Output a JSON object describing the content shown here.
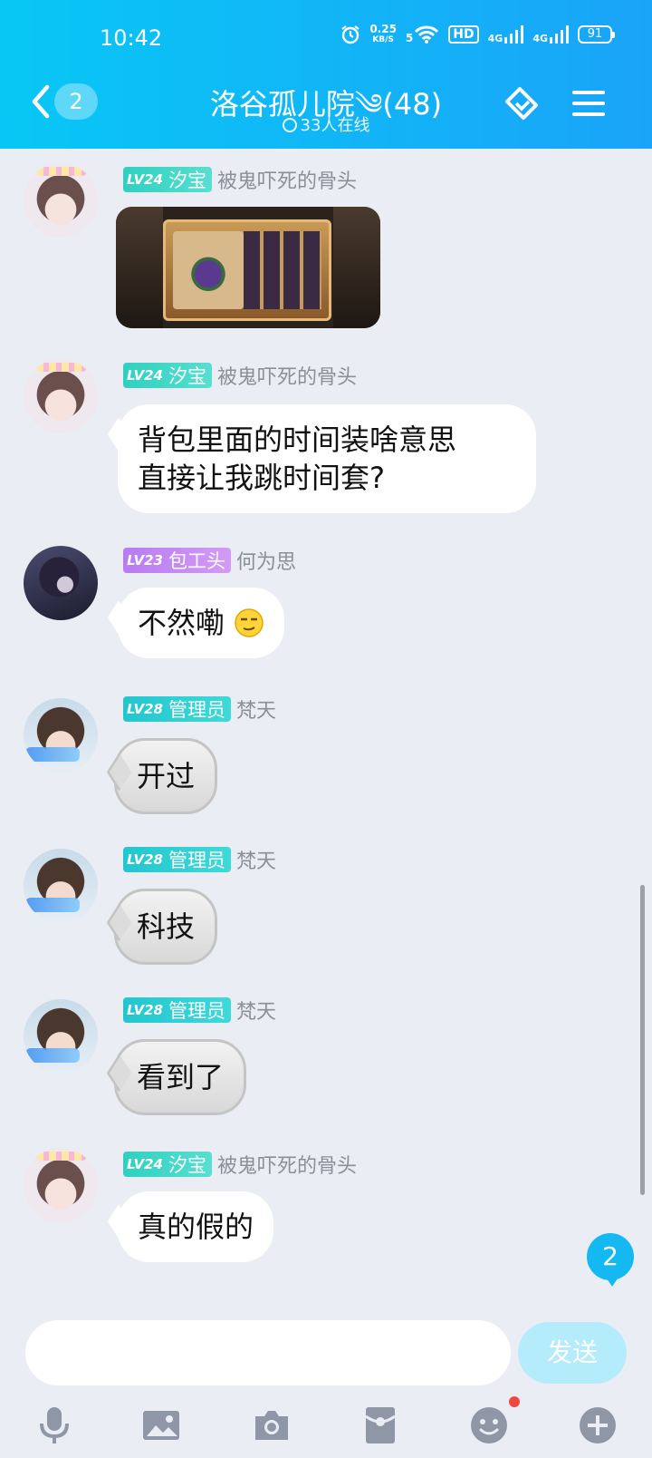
{
  "status_bar": {
    "time": "10:42",
    "speed_value": "0.25",
    "speed_unit": "KB/S",
    "wifi_label": "5",
    "hd": "HD",
    "sig1": "4G",
    "sig2": "4G",
    "battery": "91"
  },
  "header": {
    "title": "洛谷孤儿院༄(48)",
    "online": "33人在线",
    "unread_count": "2"
  },
  "messages": [
    {
      "level": "LV24",
      "title": "汐宝",
      "name": "被鬼吓死的骨头",
      "type": "image"
    },
    {
      "level": "LV24",
      "title": "汐宝",
      "name": "被鬼吓死的骨头",
      "text_line1": "背包里面的时间装啥意思",
      "text_line2": "直接让我跳时间套?"
    },
    {
      "level": "LV23",
      "title": "包工头",
      "name": "何为思",
      "text": "不然嘞"
    },
    {
      "level": "LV28",
      "title": "管理员",
      "name": "梵天",
      "text": "开过"
    },
    {
      "level": "LV28",
      "title": "管理员",
      "name": "梵天",
      "text": "科技"
    },
    {
      "level": "LV28",
      "title": "管理员",
      "name": "梵天",
      "text": "看到了"
    },
    {
      "level": "LV24",
      "title": "汐宝",
      "name": "被鬼吓死的骨头",
      "text": "真的假的"
    }
  ],
  "new_messages_count": "2",
  "input": {
    "placeholder": "",
    "send_label": "发送"
  },
  "colors": {
    "header_start": "#08c7f5",
    "header_end": "#1aa4f8",
    "badge_teal": "#2fd0c0",
    "badge_purple": "#b77cf2",
    "badge_admin": "#22c6cf",
    "send_disabled": "#b5ecfb",
    "notify_dot": "#f0473e"
  },
  "toolbar_icons": [
    "microphone-icon",
    "image-icon",
    "camera-icon",
    "red-packet-icon",
    "emoji-icon",
    "plus-icon"
  ]
}
